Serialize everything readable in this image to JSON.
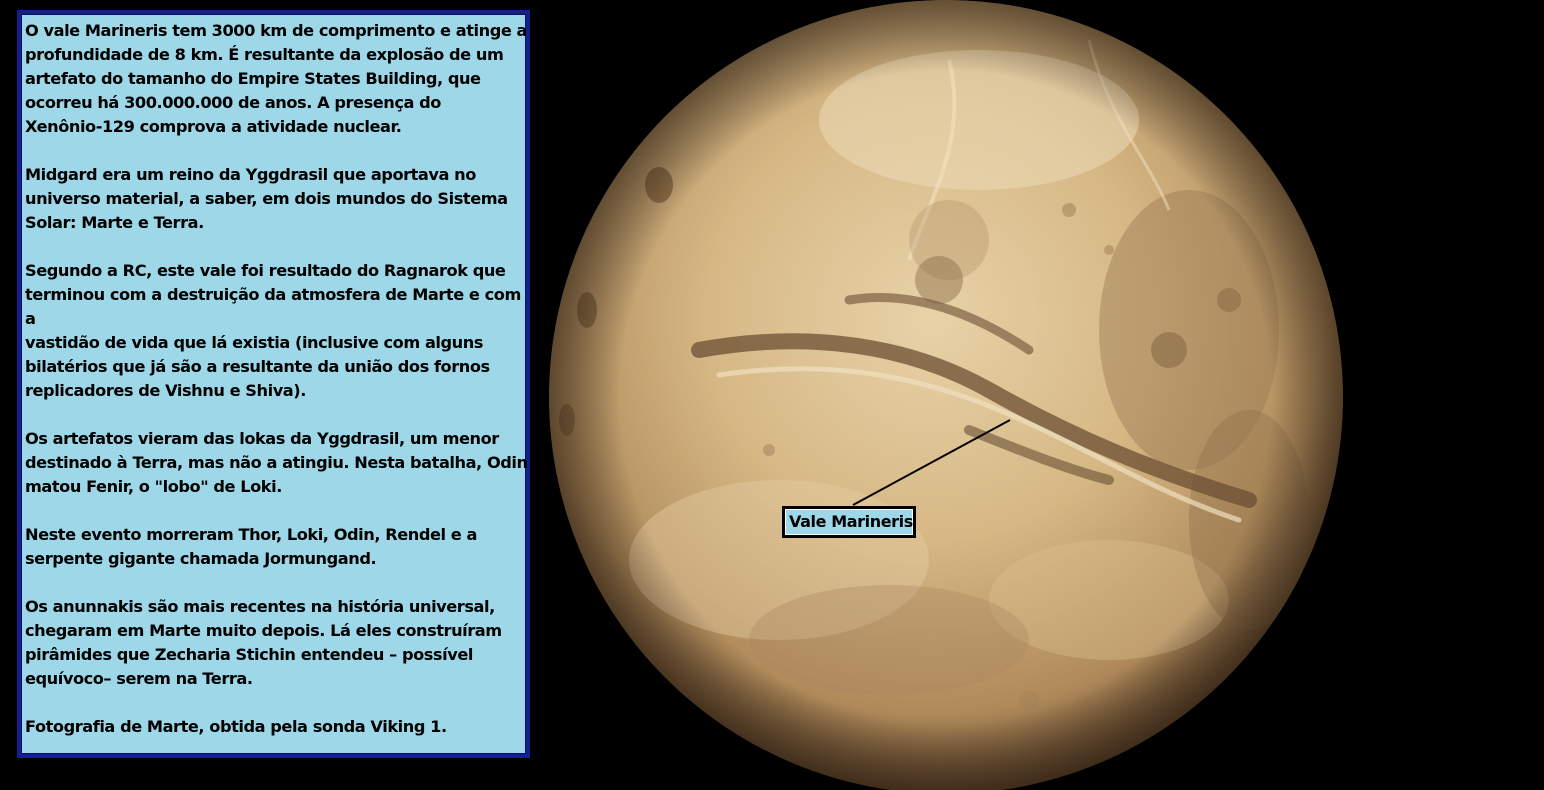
{
  "paragraphs": [
    "O vale Marineris tem 3000 km de comprimento e atinge a\nprofundidade de 8 km. É resultante da explosão de um\nartefato do tamanho do Empire States Building, que\nocorreu há 300.000.000 de anos. A presença do\nXenônio-129 comprova a atividade nuclear.",
    "Midgard era um reino da Yggdrasil que aportava no\nuniverso material, a saber, em dois mundos do Sistema\nSolar: Marte e Terra.",
    "Segundo a RC, este vale foi resultado do Ragnarok que\nterminou com a destruição da atmosfera de Marte e com a\nvastidão de vida que lá existia (inclusive com alguns\nbilatérios que já são a resultante da união dos fornos\nreplicadores de Vishnu e Shiva).",
    "Os artefatos vieram das lokas da Yggdrasil, um menor\ndestinado à Terra, mas não a atingiu. Nesta batalha, Odin\nmatou Fenir, o \"lobo\" de Loki.",
    "Neste evento morreram Thor, Loki, Odin, Rendel e a\nserpente gigante chamada Jormungand.",
    "Os anunnakis são mais recentes na história universal,\nchegaram em Marte muito depois. Lá eles construíram\npirâmides que Zecharia Stichin entendeu – possível\nequívoco– serem na Terra.",
    "Fotografia de Marte, obtida pela sonda  Viking 1."
  ],
  "planet_label": "Vale Marineris",
  "colors": {
    "page_background": "#000000",
    "text_box_background": "#9dd7e8",
    "text_box_border": "#13208e",
    "planet_light": "#e2c79a",
    "planet_mid": "#c9a672",
    "planet_dark": "#8a6a45"
  }
}
